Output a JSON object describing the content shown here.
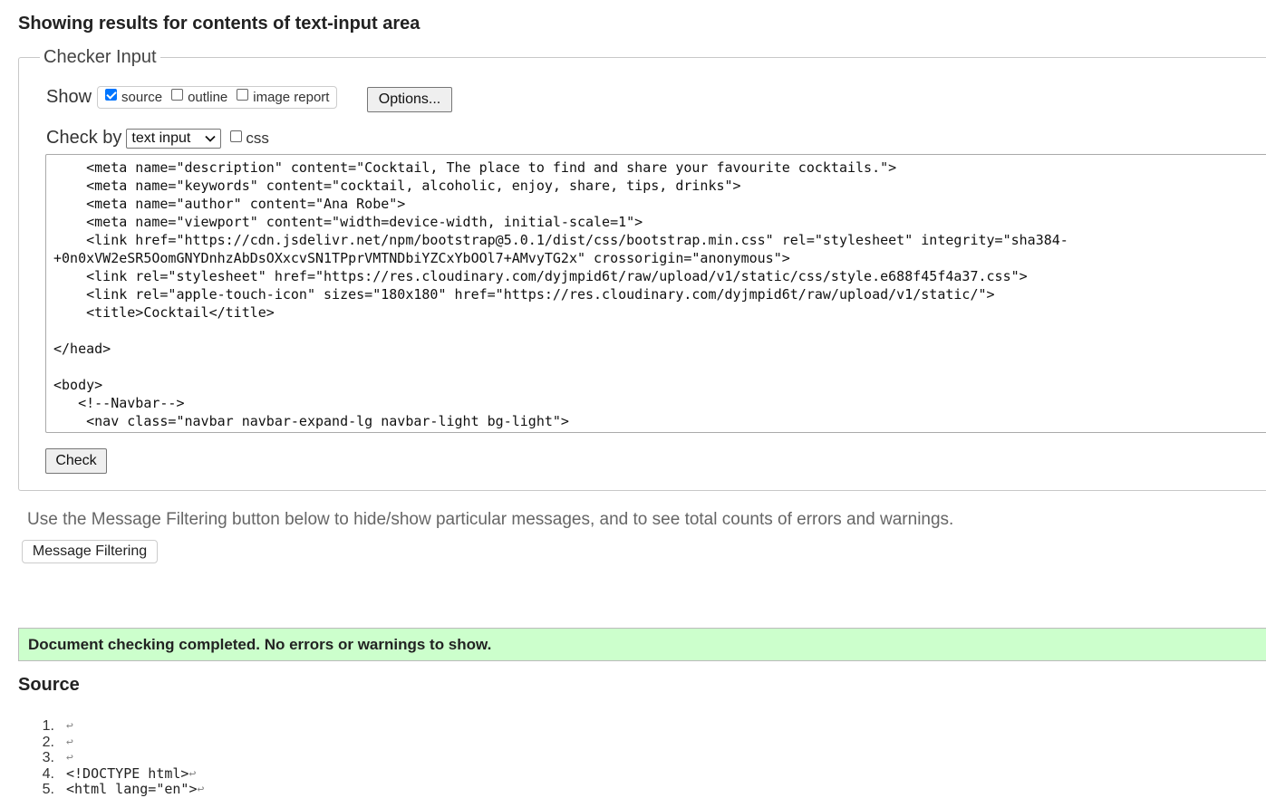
{
  "page_title": "Showing results for contents of text-input area",
  "checker": {
    "legend": "Checker Input",
    "show_label": "Show",
    "show_options": [
      {
        "label": "source",
        "checked": true
      },
      {
        "label": "outline",
        "checked": false
      },
      {
        "label": "image report",
        "checked": false
      }
    ],
    "options_button": "Options...",
    "check_by_label": "Check by",
    "check_by_selected": "text input",
    "css_label": "css",
    "css_checked": false,
    "textarea_lines": [
      "    <meta name=\"description\" content=\"Cocktail, The place to find and share your favourite cocktails.\">",
      "    <meta name=\"keywords\" content=\"cocktail, alcoholic, enjoy, share, tips, drinks\">",
      "    <meta name=\"author\" content=\"Ana Robe\">",
      "    <meta name=\"viewport\" content=\"width=device-width, initial-scale=1\">",
      "    <link href=\"https://cdn.jsdelivr.net/npm/bootstrap@5.0.1/dist/css/bootstrap.min.css\" rel=\"stylesheet\" integrity=\"sha384-",
      "+0n0xVW2eSR5OomGNYDnhzAbDsOXxcvSN1TPprVMTNDbiYZCxYbOOl7+AMvyTG2x\" crossorigin=\"anonymous\">",
      "    <link rel=\"stylesheet\" href=\"https://res.cloudinary.com/dyjmpid6t/raw/upload/v1/static/css/style.e688f45f4a37.css\">",
      "    <link rel=\"apple-touch-icon\" sizes=\"180x180\" href=\"https://res.cloudinary.com/dyjmpid6t/raw/upload/v1/static/\">",
      "    <title>Cocktail</title>",
      "",
      "</head>",
      "",
      "<body>",
      "   <!--Navbar-->",
      "    <nav class=\"navbar navbar-expand-lg navbar-light bg-light\">"
    ],
    "check_button": "Check"
  },
  "filter_hint": "Use the Message Filtering button below to hide/show particular messages, and to see total counts of errors and warnings.",
  "filter_button": "Message Filtering",
  "status_message": "Document checking completed. No errors or warnings to show.",
  "source_heading": "Source",
  "source_lines": [
    {
      "num": "1.",
      "code": ""
    },
    {
      "num": "2.",
      "code": ""
    },
    {
      "num": "3.",
      "code": ""
    },
    {
      "num": "4.",
      "code": "<!DOCTYPE html>"
    },
    {
      "num": "5.",
      "code": "<html lang=\"en\">"
    }
  ],
  "return_glyph": "↩",
  "colors": {
    "status_bg": "#ccffcc",
    "checkbox_accent": "#0075ff"
  }
}
